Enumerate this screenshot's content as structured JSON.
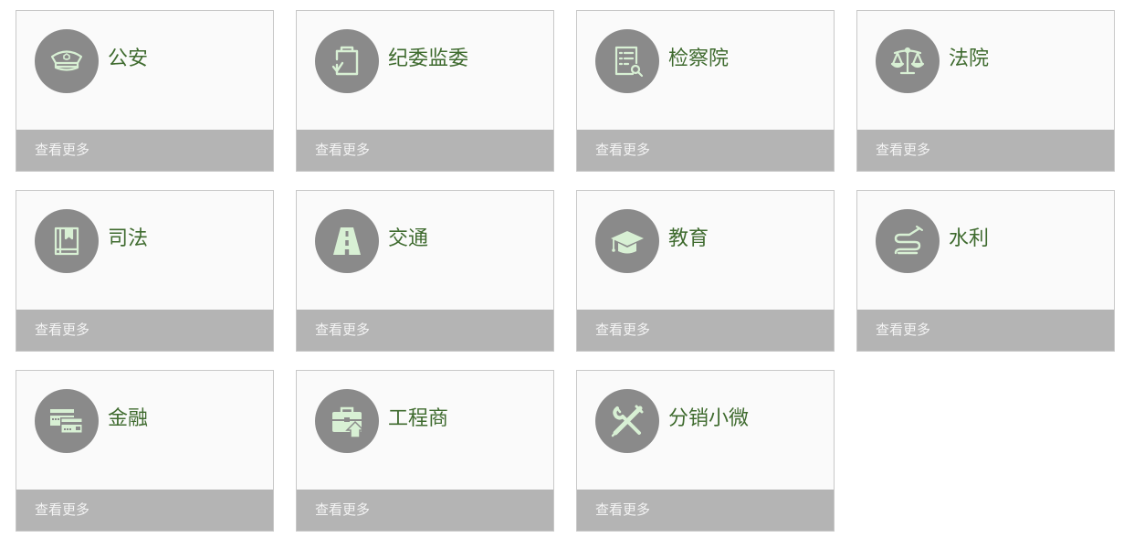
{
  "more_label": "查看更多",
  "colors": {
    "card_bg": "#fafafa",
    "card_border": "#c8c8c8",
    "footer_bg": "#b4b4b4",
    "icon_circle": "#8a8a8a",
    "icon_glyph": "#d8f0d4",
    "title_text": "#3f6b2f"
  },
  "cards": [
    {
      "title": "公安",
      "icon": "police-cap-icon"
    },
    {
      "title": "纪委监委",
      "icon": "clipboard-check-icon"
    },
    {
      "title": "检察院",
      "icon": "document-search-icon"
    },
    {
      "title": "法院",
      "icon": "scales-icon"
    },
    {
      "title": "司法",
      "icon": "law-book-icon"
    },
    {
      "title": "交通",
      "icon": "road-icon"
    },
    {
      "title": "教育",
      "icon": "graduation-cap-icon"
    },
    {
      "title": "水利",
      "icon": "water-pipe-icon"
    },
    {
      "title": "金融",
      "icon": "bank-cards-icon"
    },
    {
      "title": "工程商",
      "icon": "briefcase-upload-icon"
    },
    {
      "title": "分销小微",
      "icon": "tools-icon"
    }
  ]
}
